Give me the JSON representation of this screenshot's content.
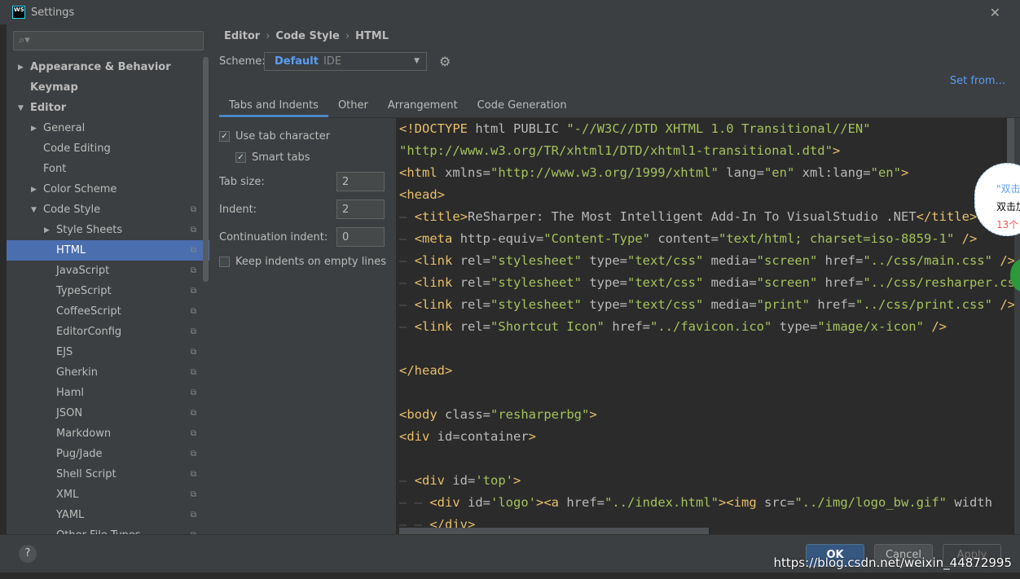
{
  "window": {
    "title": "Settings",
    "logo": "WS"
  },
  "sidebar": {
    "search_placeholder": "",
    "items": [
      {
        "label": "Appearance & Behavior",
        "arrow": "▶",
        "bold": true,
        "indent": 0
      },
      {
        "label": "Keymap",
        "arrow": "",
        "bold": true,
        "indent": 0
      },
      {
        "label": "Editor",
        "arrow": "▼",
        "bold": true,
        "indent": 0
      },
      {
        "label": "General",
        "arrow": "▶",
        "indent": 1
      },
      {
        "label": "Code Editing",
        "arrow": "",
        "indent": 1
      },
      {
        "label": "Font",
        "arrow": "",
        "indent": 1
      },
      {
        "label": "Color Scheme",
        "arrow": "▶",
        "indent": 1
      },
      {
        "label": "Code Style",
        "arrow": "▼",
        "indent": 1,
        "copy": true
      },
      {
        "label": "Style Sheets",
        "arrow": "▶",
        "indent": 2,
        "copy": true
      },
      {
        "label": "HTML",
        "arrow": "",
        "indent": 2,
        "copy": true,
        "selected": true
      },
      {
        "label": "JavaScript",
        "indent": 2,
        "copy": true
      },
      {
        "label": "TypeScript",
        "indent": 2,
        "copy": true
      },
      {
        "label": "CoffeeScript",
        "indent": 2,
        "copy": true
      },
      {
        "label": "EditorConfig",
        "indent": 2,
        "copy": true
      },
      {
        "label": "EJS",
        "indent": 2,
        "copy": true
      },
      {
        "label": "Gherkin",
        "indent": 2,
        "copy": true
      },
      {
        "label": "Haml",
        "indent": 2,
        "copy": true
      },
      {
        "label": "JSON",
        "indent": 2,
        "copy": true
      },
      {
        "label": "Markdown",
        "indent": 2,
        "copy": true
      },
      {
        "label": "Pug/Jade",
        "indent": 2,
        "copy": true
      },
      {
        "label": "Shell Script",
        "indent": 2,
        "copy": true
      },
      {
        "label": "XML",
        "indent": 2,
        "copy": true
      },
      {
        "label": "YAML",
        "indent": 2,
        "copy": true
      },
      {
        "label": "Other File Types",
        "indent": 2,
        "copy": true
      }
    ]
  },
  "breadcrumb": [
    "Editor",
    "Code Style",
    "HTML"
  ],
  "scheme": {
    "label": "Scheme:",
    "name": "Default",
    "type": "IDE"
  },
  "set_from": "Set from...",
  "tabs": [
    "Tabs and Indents",
    "Other",
    "Arrangement",
    "Code Generation"
  ],
  "options": {
    "use_tab": "Use tab character",
    "use_tab_checked": true,
    "smart_tabs": "Smart tabs",
    "smart_tabs_checked": true,
    "tab_size_label": "Tab size:",
    "tab_size": "2",
    "indent_label": "Indent:",
    "indent": "2",
    "cont_label": "Continuation indent:",
    "cont": "0",
    "keep_indents": "Keep indents on empty lines",
    "keep_indents_checked": false
  },
  "code_lines": [
    "<!DOCTYPE html PUBLIC \"-//W3C//DTD XHTML 1.0 Transitional//EN\"",
    "\"http://www.w3.org/TR/xhtml1/DTD/xhtml1-transitional.dtd\">",
    "<html xmlns=\"http://www.w3.org/1999/xhtml\" lang=\"en\" xml:lang=\"en\">",
    "<head>",
    "— <title>ReSharper: The Most Intelligent Add-In To VisualStudio .NET</title>",
    "— <meta http-equiv=\"Content-Type\" content=\"text/html; charset=iso-8859-1\" />",
    "— <link rel=\"stylesheet\" type=\"text/css\" media=\"screen\" href=\"../css/main.css\" />",
    "— <link rel=\"stylesheet\" type=\"text/css\" media=\"screen\" href=\"../css/resharper.css\" />",
    "— <link rel=\"stylesheet\" type=\"text/css\" media=\"print\" href=\"../css/print.css\" />",
    "— <link rel=\"Shortcut Icon\" href=\"../favicon.ico\" type=\"image/x-icon\" />",
    "",
    "</head>",
    "",
    "<body class=\"resharperbg\">",
    "<div id=container>",
    "",
    "— <div id='top'>",
    "— — <div id='logo'><a href=\"../index.html\"><img src=\"../img/logo_bw.gif\" width",
    "— — </div>"
  ],
  "buttons": {
    "help": "?",
    "ok": "OK",
    "cancel": "Cancel",
    "apply": "Apply"
  },
  "overlay": {
    "watermark": "https://blog.csdn.net/weixin_44872995",
    "bubble_1": "\"双击",
    "bubble_2": "双击加",
    "bubble_3": "13个"
  },
  "colors": {
    "accent": "#4b6eaf",
    "tag": "#e8bf6a",
    "value": "#a5c25c",
    "link": "#589df6"
  }
}
